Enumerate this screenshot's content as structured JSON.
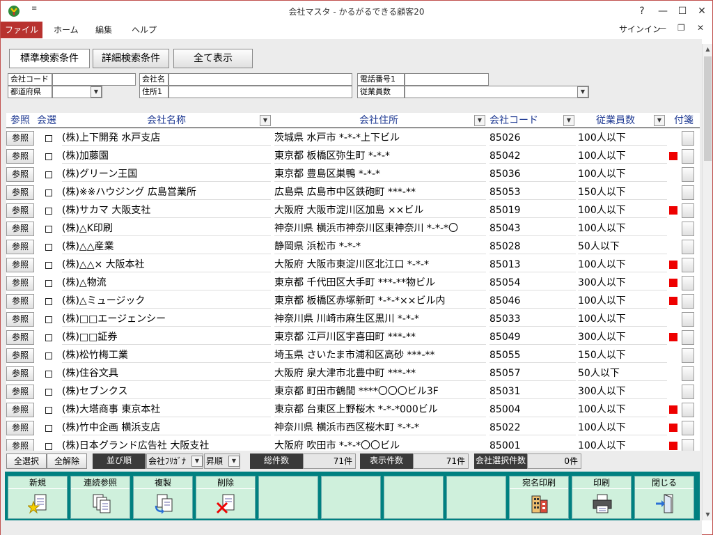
{
  "title": "会社マスタ - かるがるできる顧客20",
  "qat": "≡",
  "window": {
    "help": "?",
    "minimize": "—",
    "maximize": "☐",
    "close": "✕"
  },
  "ribbon": {
    "tabs": [
      "ファイル",
      "ホーム",
      "編集",
      "ヘルプ"
    ],
    "signin": "サインイン",
    "min": "—",
    "restore": "❐",
    "close": "✕"
  },
  "search": {
    "standard": "標準検索条件",
    "detailed": "詳細検索条件",
    "show_all": "全て表示",
    "company_code": "会社コード",
    "prefecture": "都道府県",
    "company_name": "会社名",
    "address1": "住所1",
    "phone1": "電話番号1",
    "employees": "従業員数"
  },
  "columns": {
    "ref": "参照",
    "select": "会選",
    "name": "会社名称",
    "address": "会社住所",
    "code": "会社コード",
    "employees": "従業員数",
    "tag": "付箋"
  },
  "ref_label": "参照",
  "rows": [
    {
      "name": "(株)上下開発 水戸支店",
      "address": "茨城県 水戸市 *-*-*上下ビル",
      "code": "85026",
      "employees": "100人以下",
      "tag_red": false
    },
    {
      "name": "(株)加藤園",
      "address": "東京都 板橋区弥生町 *-*-*",
      "code": "85042",
      "employees": "100人以下",
      "tag_red": true
    },
    {
      "name": "(株)グリーン王国",
      "address": "東京都 豊島区巣鴨 *-*-*",
      "code": "85036",
      "employees": "100人以下",
      "tag_red": false
    },
    {
      "name": "(株)※※ハウジング 広島営業所",
      "address": "広島県 広島市中区鉄砲町 ***-**",
      "code": "85053",
      "employees": "150人以下",
      "tag_red": false
    },
    {
      "name": "(株)サカマ 大阪支社",
      "address": "大阪府 大阪市淀川区加島 ××ビル",
      "code": "85019",
      "employees": "100人以下",
      "tag_red": true
    },
    {
      "name": "(株)△K印刷",
      "address": "神奈川県 横浜市神奈川区東神奈川 *-*-*〇",
      "code": "85043",
      "employees": "100人以下",
      "tag_red": false
    },
    {
      "name": "(株)△△産業",
      "address": "静岡県 浜松市 *-*-*",
      "code": "85028",
      "employees": "50人以下",
      "tag_red": false
    },
    {
      "name": "(株)△△× 大阪本社",
      "address": "大阪府 大阪市東淀川区北江口 *-*-*",
      "code": "85013",
      "employees": "100人以下",
      "tag_red": true
    },
    {
      "name": "(株)△物流",
      "address": "東京都 千代田区大手町 ***-**物ビル",
      "code": "85054",
      "employees": "300人以下",
      "tag_red": true
    },
    {
      "name": "(株)△ミュージック",
      "address": "東京都 板橋区赤塚新町 *-*-*××ビル内",
      "code": "85046",
      "employees": "100人以下",
      "tag_red": true
    },
    {
      "name": "(株)□□エージェンシー",
      "address": "神奈川県 川崎市麻生区黒川 *-*-*",
      "code": "85033",
      "employees": "100人以下",
      "tag_red": false
    },
    {
      "name": "(株)□□証券",
      "address": "東京都 江戸川区宇喜田町 ***-**",
      "code": "85049",
      "employees": "300人以下",
      "tag_red": true
    },
    {
      "name": "(株)松竹梅工業",
      "address": "埼玉県 さいたま市浦和区高砂 ***-**",
      "code": "85055",
      "employees": "150人以下",
      "tag_red": false
    },
    {
      "name": "(株)住谷文具",
      "address": "大阪府 泉大津市北豊中町 ***-**",
      "code": "85057",
      "employees": "50人以下",
      "tag_red": false
    },
    {
      "name": "(株)セブンクス",
      "address": "東京都 町田市鶴間 ****〇〇〇ビル3F",
      "code": "85031",
      "employees": "300人以下",
      "tag_red": false
    },
    {
      "name": "(株)大塔商事 東京本社",
      "address": "東京都 台東区上野桜木 *-*-*000ビル",
      "code": "85004",
      "employees": "100人以下",
      "tag_red": true
    },
    {
      "name": "(株)竹中企画 横浜支店",
      "address": "神奈川県 横浜市西区桜木町 *-*-*",
      "code": "85022",
      "employees": "100人以下",
      "tag_red": true
    },
    {
      "name": "(株)日本グランド広告社 大阪支社",
      "address": "大阪府 吹田市 *-*-*〇〇ビル",
      "code": "85001",
      "employees": "100人以下",
      "tag_red": true
    }
  ],
  "bottom": {
    "select_all": "全選択",
    "deselect_all": "全解除",
    "sort_label": "並び順",
    "sort_field": "会社ﾌﾘｶﾞﾅ",
    "sort_order": "昇順",
    "total_label": "総件数",
    "total_value": "71件",
    "shown_label": "表示件数",
    "shown_value": "71件",
    "selected_label": "会社選択件数",
    "selected_value": "0件"
  },
  "actions": {
    "new": "新規",
    "continuous_ref": "連続参照",
    "copy": "複製",
    "delete": "削除",
    "label_print": "宛名印刷",
    "print": "印刷",
    "close": "閉じる"
  },
  "colors": {
    "accent": "#b8322f",
    "action_bar": "#008080",
    "tag_red": "#e00000"
  }
}
